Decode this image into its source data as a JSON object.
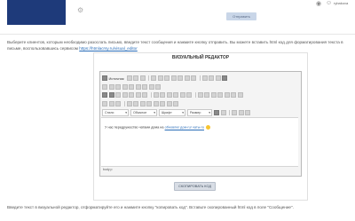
{
  "header": {
    "top_button_label": "Отправить",
    "user_name": "rybakova"
  },
  "intro": {
    "text": "Выберите клиентов, которым необходимо разослать письмо, введите текст сообщения и нажмите кнопку отправить. Вы можете вставить html код для форматирования текста в письме, воспользовавшись сервисом",
    "link": "https://htmlacrsy.ru/visual_editor"
  },
  "panel": {
    "title": "ВИЗУАЛЬНЫЙ РЕДАКТОР"
  },
  "toolbar": {
    "source_label": "Источник",
    "style_select": "Стили",
    "format_select": "Обычное",
    "font_select": "Шрифт",
    "size_select": "Размер"
  },
  "editor": {
    "content_prefix": "У нас передружество чатами дома на",
    "content_link": "обновлю/ дом-ru/ чаты-ru",
    "status_text": "body p"
  },
  "copy_button": {
    "label": "СКОПИРОВАТЬ КОД"
  },
  "bottom_text": "Введите текст в визуальной редактор, отформатируйте его и нажмите кнопку \"копировать код\". Вставьте скопированный html код в поле \"Сообщение\"."
}
